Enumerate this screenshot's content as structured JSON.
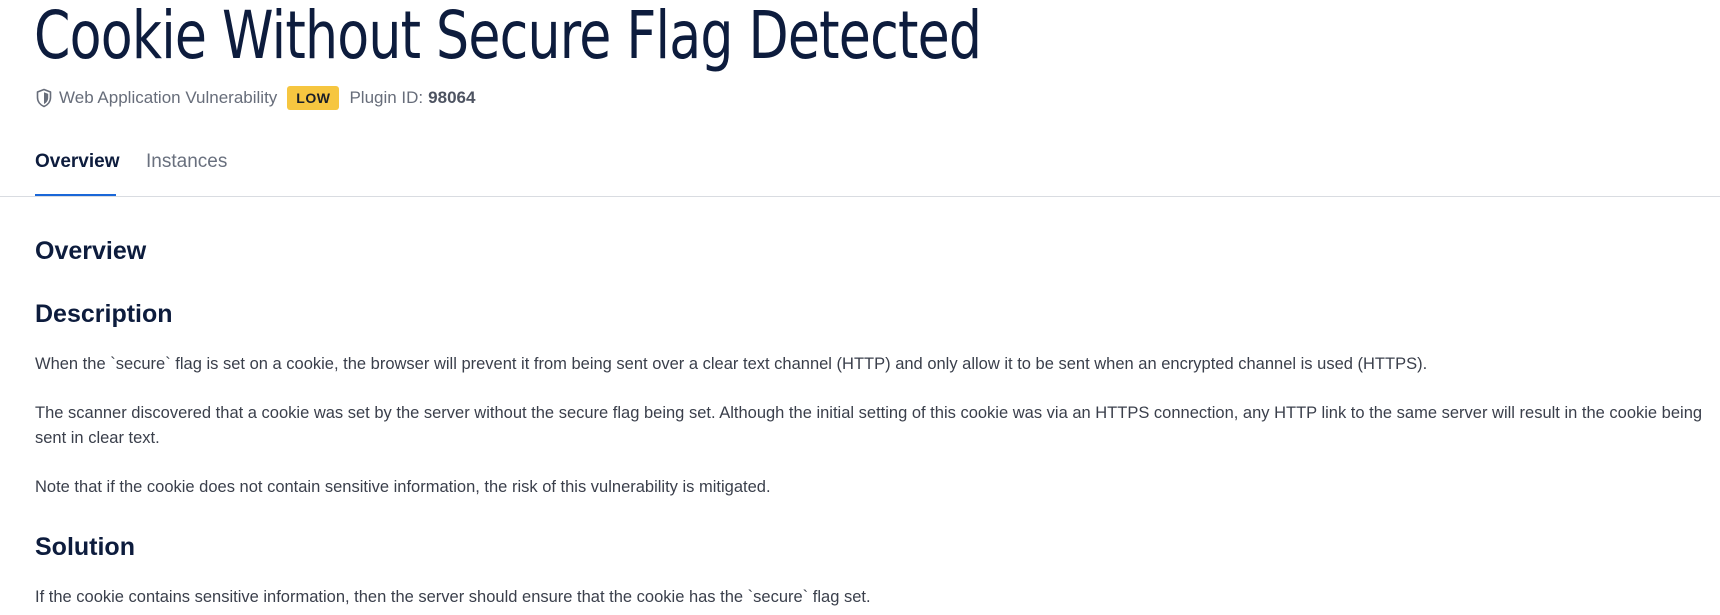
{
  "header": {
    "title": "Cookie Without Secure Flag Detected",
    "category": "Web Application Vulnerability",
    "severity": "LOW",
    "plugin_label": "Plugin ID:",
    "plugin_id": "98064"
  },
  "tabs": [
    {
      "label": "Overview",
      "active": true
    },
    {
      "label": "Instances",
      "active": false
    }
  ],
  "content": {
    "section_title": "Overview",
    "description_title": "Description",
    "description_paragraphs": [
      "When the `secure` flag is set on a cookie, the browser will prevent it from being sent over a clear text channel (HTTP) and only allow it to be sent when an encrypted channel is used (HTTPS).",
      "The scanner discovered that a cookie was set by the server without the secure flag being set. Although the initial setting of this cookie was via an HTTPS connection, any HTTP link to the same server will result in the cookie being sent in clear text.",
      "Note that if the cookie does not contain sensitive information, the risk of this vulnerability is mitigated."
    ],
    "solution_title": "Solution",
    "solution_text": "If the cookie contains sensitive information, then the server should ensure that the cookie has the `secure` flag set."
  },
  "colors": {
    "title": "#0d1c3d",
    "badge_low": "#f6c640",
    "tab_active_underline": "#1a67d8"
  },
  "icons": {
    "category_icon": "shield-icon"
  }
}
